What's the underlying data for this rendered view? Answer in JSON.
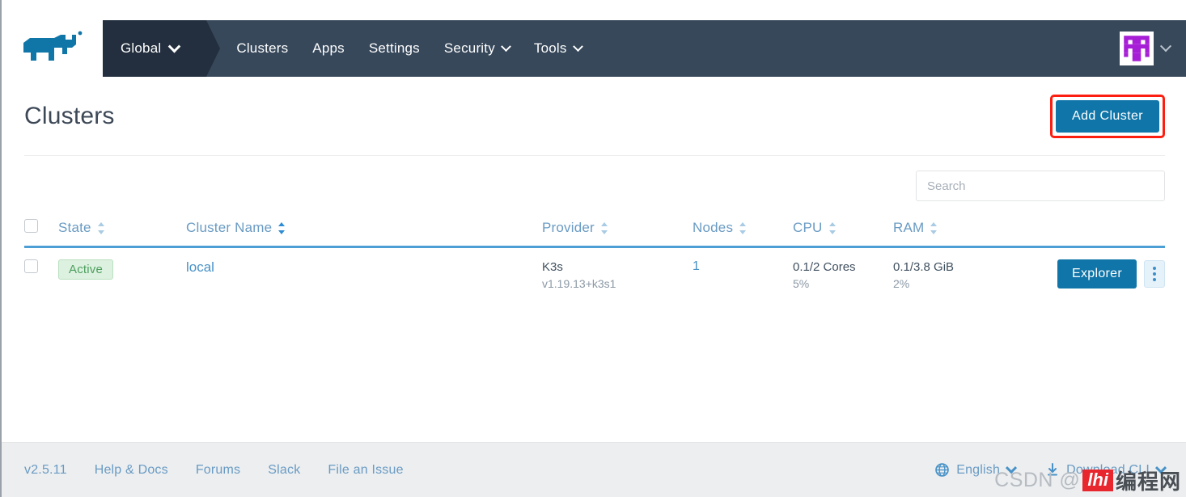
{
  "header": {
    "logo_alt": "rancher-cow-logo",
    "logo_color": "#1076a8",
    "scope_label": "Global",
    "nav_items": [
      {
        "label": "Clusters",
        "has_dropdown": false
      },
      {
        "label": "Apps",
        "has_dropdown": false
      },
      {
        "label": "Settings",
        "has_dropdown": false
      },
      {
        "label": "Security",
        "has_dropdown": true
      },
      {
        "label": "Tools",
        "has_dropdown": true
      }
    ],
    "avatar_name": "user-avatar-identicon",
    "avatar_color": "#a61fd6",
    "nav_bg": "#37485b",
    "scope_bg": "#232f3e"
  },
  "page": {
    "title": "Clusters",
    "add_cluster_label": "Add Cluster",
    "add_cluster_highlight_color": "#fc1e10",
    "primary_color": "#1075a8"
  },
  "search": {
    "value": "",
    "placeholder": "Search"
  },
  "table": {
    "columns": [
      {
        "label": "State",
        "sortable": true,
        "sorted": false
      },
      {
        "label": "Cluster Name",
        "sortable": true,
        "sorted": true
      },
      {
        "label": "Provider",
        "sortable": true,
        "sorted": false
      },
      {
        "label": "Nodes",
        "sortable": true,
        "sorted": false
      },
      {
        "label": "CPU",
        "sortable": true,
        "sorted": false
      },
      {
        "label": "RAM",
        "sortable": true,
        "sorted": false
      }
    ],
    "rows": [
      {
        "state": "Active",
        "state_color": "#4d9f5e",
        "name": "local",
        "provider": "K3s",
        "provider_version": "v1.19.13+k3s1",
        "nodes": "1",
        "cpu": "0.1/2 Cores",
        "cpu_percent": "5%",
        "ram": "0.1/3.8 GiB",
        "ram_percent": "2%",
        "action_label": "Explorer"
      }
    ]
  },
  "footer": {
    "version": "v2.5.11",
    "links": [
      {
        "label": "Help & Docs"
      },
      {
        "label": "Forums"
      },
      {
        "label": "Slack"
      },
      {
        "label": "File an Issue"
      }
    ],
    "language": "English",
    "download_cli": "Download CLI"
  },
  "watermark": {
    "prefix": "CSDN @",
    "logo_text": "lhi",
    "suffix": "编程网"
  }
}
